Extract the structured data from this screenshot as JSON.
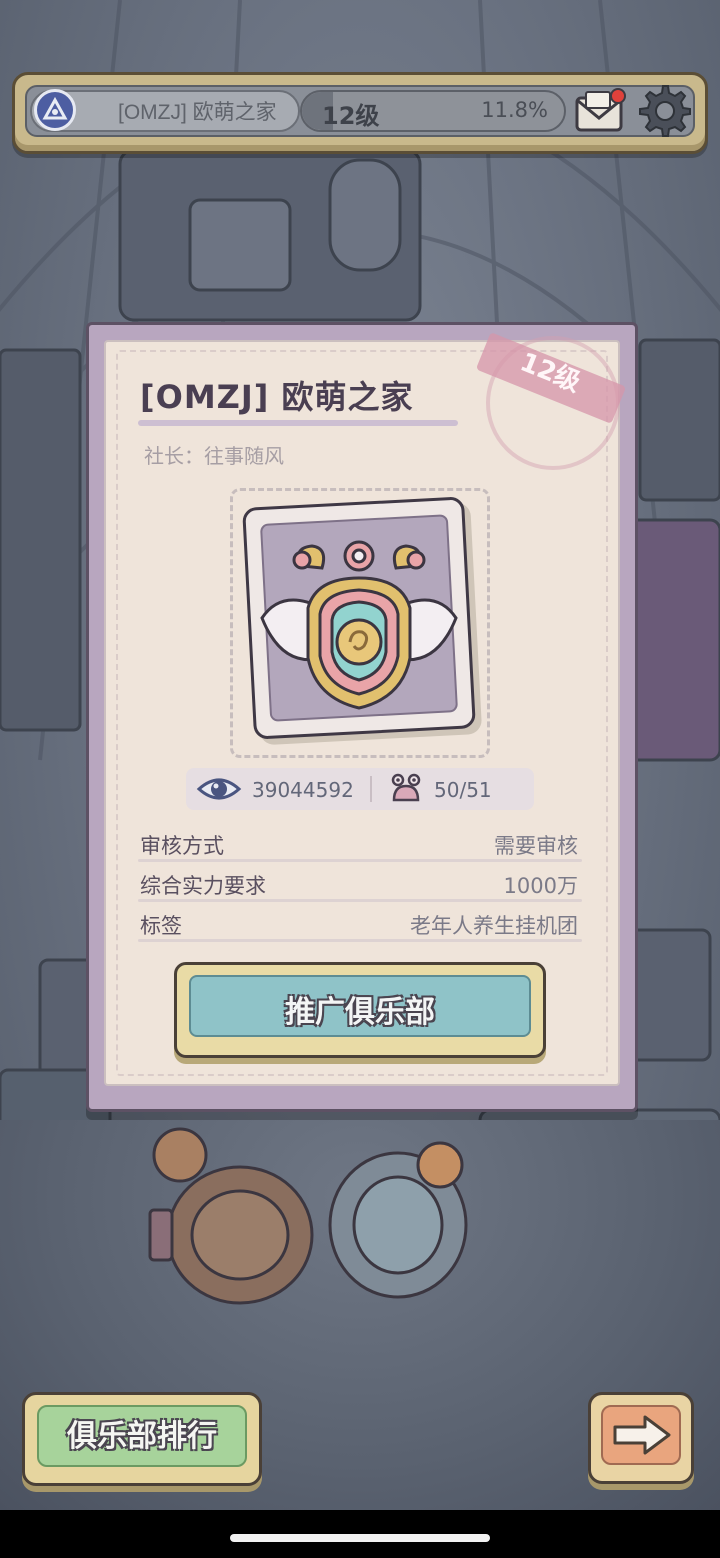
{
  "topbar": {
    "club_name": "[OMZJ] 欧萌之家",
    "level": "12级",
    "progress_percent": "11.8%",
    "progress_fraction": 0.118,
    "icons": {
      "emblem": "club-emblem-icon",
      "mail": "mail-icon",
      "settings": "gear-icon"
    },
    "mail_has_notification": true
  },
  "panel": {
    "title": "[OMZJ] 欧萌之家",
    "level_stamp": "12级",
    "leader": "社长：往事随风",
    "badge_icon": "winged-shield-badge-icon",
    "stats": {
      "views": "39044592",
      "members": "50/51",
      "views_icon": "eye-icon",
      "members_icon": "member-icon"
    },
    "info": [
      {
        "label": "审核方式",
        "value": "需要审核"
      },
      {
        "label": "综合实力要求",
        "value": "1000万"
      },
      {
        "label": "标签",
        "value": "老年人养生挂机团"
      }
    ],
    "promote_button": "推广俱乐部"
  },
  "bottom": {
    "ranking_button": "俱乐部排行",
    "next_icon": "arrow-right-icon"
  },
  "colors": {
    "panel_frame": "#b8a6bf",
    "paper": "#efe4da",
    "promote_button": "#8fc3c8",
    "ranking_button": "#a7d39b",
    "next_button": "#e9a57e",
    "notification_dot": "#e0413b"
  }
}
